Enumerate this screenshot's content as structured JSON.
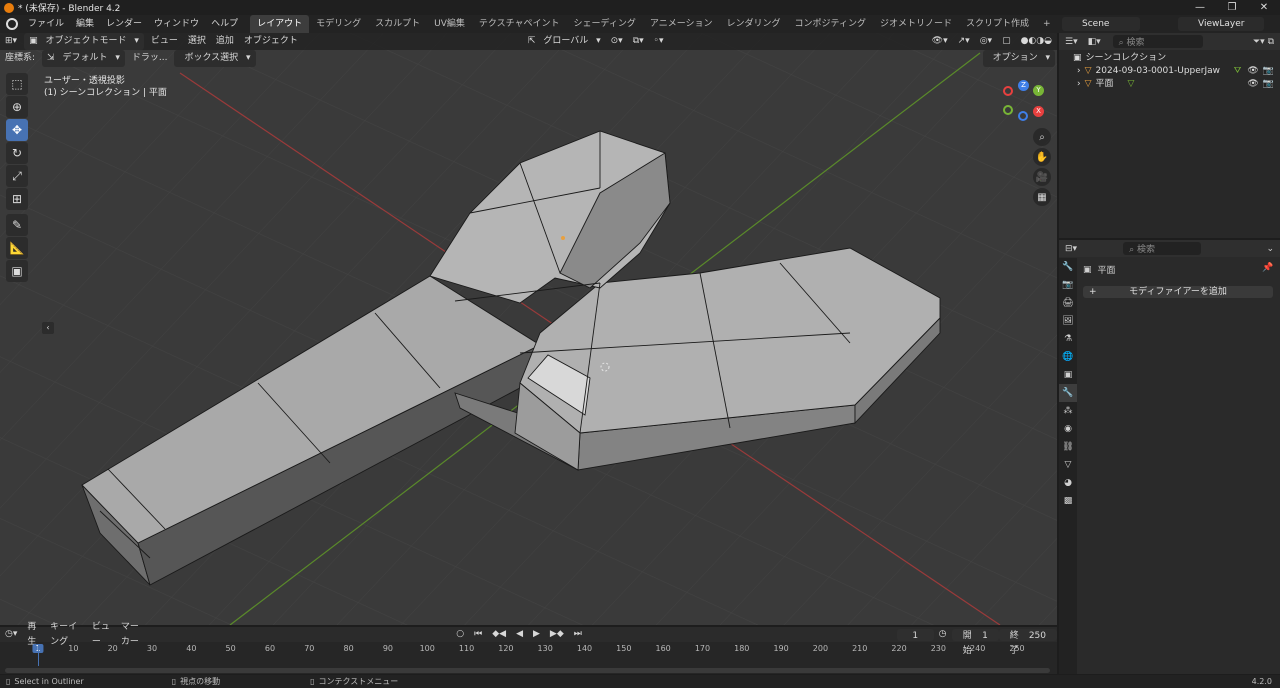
{
  "window": {
    "title": "* (未保存) - Blender 4.2",
    "controls": [
      "—",
      "❐",
      "✕"
    ]
  },
  "topbar": {
    "menus": [
      "ファイル",
      "編集",
      "レンダー",
      "ウィンドウ",
      "ヘルプ"
    ],
    "workspaces": [
      "レイアウト",
      "モデリング",
      "スカルプト",
      "UV編集",
      "テクスチャペイント",
      "シェーディング",
      "アニメーション",
      "レンダリング",
      "コンポジティング",
      "ジオメトリノード",
      "スクリプト作成"
    ],
    "active_workspace": "レイアウト",
    "add_workspace": "+",
    "scene": "Scene",
    "view_layer": "ViewLayer"
  },
  "viewport_header": {
    "mode": "オブジェクトモード",
    "menus": [
      "ビュー",
      "選択",
      "追加",
      "オブジェクト"
    ],
    "orientation": "グローバル",
    "options": "オプション"
  },
  "viewport_header2": {
    "coord_label": "座標系:",
    "coord_value": "デフォルト",
    "drag_label": "ドラッ...",
    "select_mode": "ボックス選択"
  },
  "viewport": {
    "view_name": "ユーザー・透視投影",
    "collection_info": "(1) シーンコレクション | 平面"
  },
  "gizmo": {
    "x": "X",
    "y": "Y",
    "z": "Z"
  },
  "outliner": {
    "search_placeholder": "検索",
    "root": "シーンコレクション",
    "items": [
      {
        "name": "2024-09-03-0001-UpperJaw"
      },
      {
        "name": "平面"
      }
    ]
  },
  "properties": {
    "search_placeholder": "検索",
    "object_name": "平面",
    "add_modifier": "モディファイアーを追加"
  },
  "timeline": {
    "menus": [
      "再生",
      "キーイング",
      "ビュー",
      "マーカー"
    ],
    "current_frame": "1",
    "start_label": "開始",
    "start_value": "1",
    "end_label": "終了",
    "end_value": "250",
    "ruler": [
      "1",
      "10",
      "20",
      "30",
      "40",
      "50",
      "60",
      "70",
      "80",
      "90",
      "100",
      "110",
      "120",
      "130",
      "140",
      "150",
      "160",
      "170",
      "180",
      "190",
      "200",
      "210",
      "220",
      "230",
      "240",
      "250"
    ]
  },
  "statusbar": {
    "left": "Select in Outliner",
    "mid": "視点の移動",
    "right": "コンテクストメニュー",
    "version": "4.2.0"
  },
  "colors": {
    "accent": "#4772b3",
    "x_axis": "#e8403f",
    "y_axis": "#78b536",
    "z_axis": "#3f7fe8"
  }
}
